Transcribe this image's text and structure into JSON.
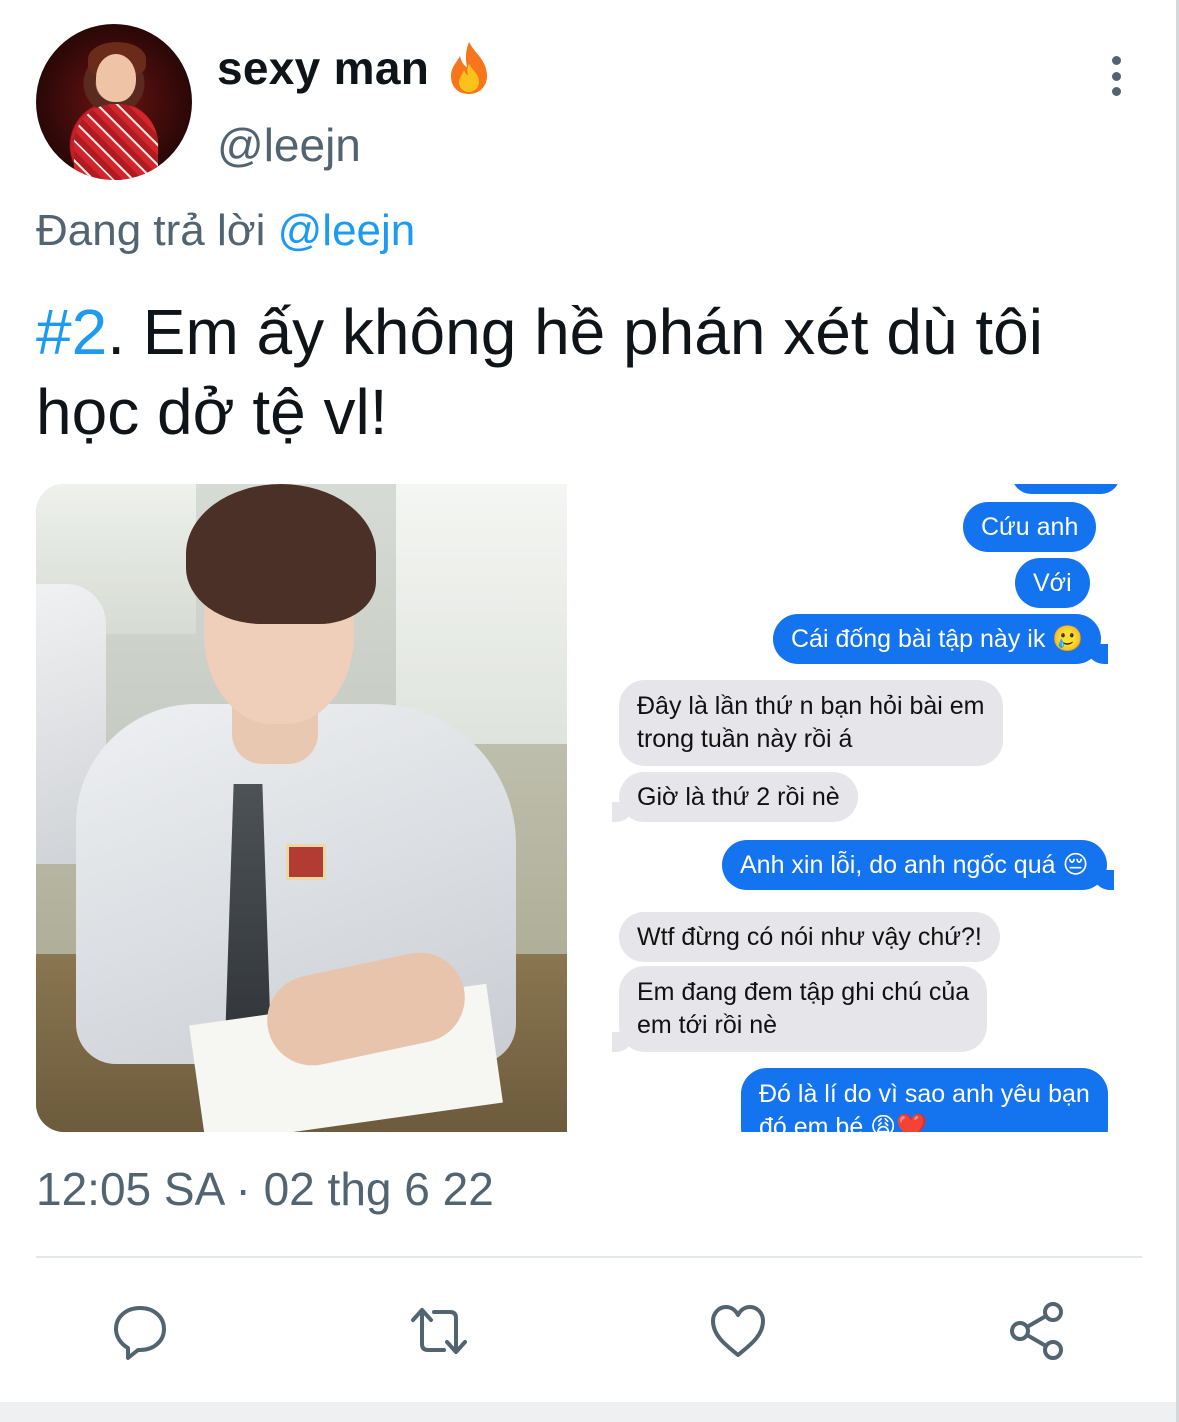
{
  "author": {
    "display_name": "sexy man",
    "emoji_icon": "fire-icon",
    "handle": "@leejn"
  },
  "reply": {
    "prefix": "Đang trả lời",
    "mention": "@leejn"
  },
  "tweet": {
    "hashtag": "#2",
    "text": ". Em ấy không hề phán xét dù tôi học dở tệ vl!"
  },
  "chat": {
    "messages": [
      {
        "side": "out",
        "text": "Cứu anh"
      },
      {
        "side": "out",
        "text": "Với"
      },
      {
        "side": "out",
        "text": "Cái đống bài tập này ik 🥲"
      },
      {
        "side": "in",
        "line1": "Đây là lần thứ n bạn hỏi bài em",
        "line2": "trong tuần này rồi á"
      },
      {
        "side": "in",
        "text": "Giờ là thứ 2 rồi nè"
      },
      {
        "side": "out",
        "text": "Anh xin lỗi, do anh ngốc quá 😔"
      },
      {
        "side": "in",
        "text": "Wtf đừng có nói như vậy chứ?!"
      },
      {
        "side": "in",
        "line1": "Em đang đem tập ghi chú của",
        "line2": "em tới rồi nè"
      },
      {
        "side": "out",
        "line1": "Đó là lí do vì sao anh yêu bạn",
        "line2": "đó em bé 😩❤️"
      }
    ]
  },
  "timestamp": "12:05 SA · 02 thg 6 22",
  "actions": {
    "reply_icon": "reply-icon",
    "retweet_icon": "retweet-icon",
    "like_icon": "heart-icon",
    "share_icon": "share-icon"
  },
  "colors": {
    "accent": "#1d9bf0",
    "secondary_text": "#536471",
    "imessage_blue": "#1473ee",
    "imessage_gray": "#e5e5ea"
  }
}
